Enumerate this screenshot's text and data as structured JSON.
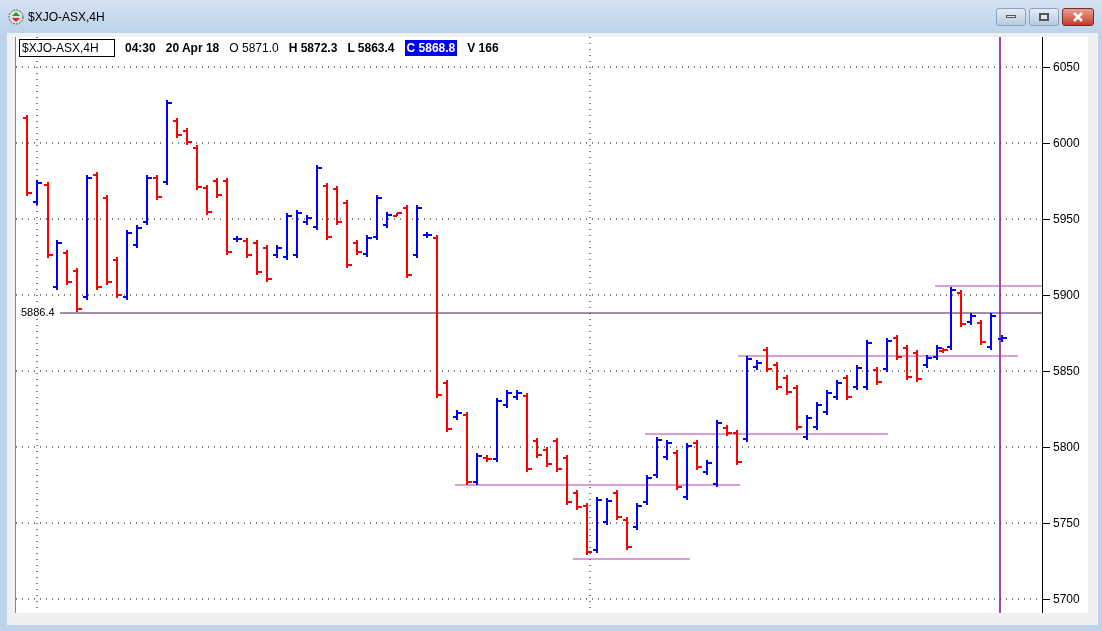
{
  "window": {
    "title": "$XJO-ASX,4H"
  },
  "legend": {
    "symbol": "$XJO-ASX,4H",
    "time": "04:30",
    "date": "20 Apr 18",
    "open": "O 5871.0",
    "high": "H 5872.3",
    "low": "L 5863.4",
    "close": "C 5868.8",
    "volume": "V 166"
  },
  "crosshair_label": "5886.4",
  "price_axis": [
    "6050",
    "6000",
    "5950",
    "5900",
    "5850",
    "5800",
    "5750",
    "5700"
  ]
}
